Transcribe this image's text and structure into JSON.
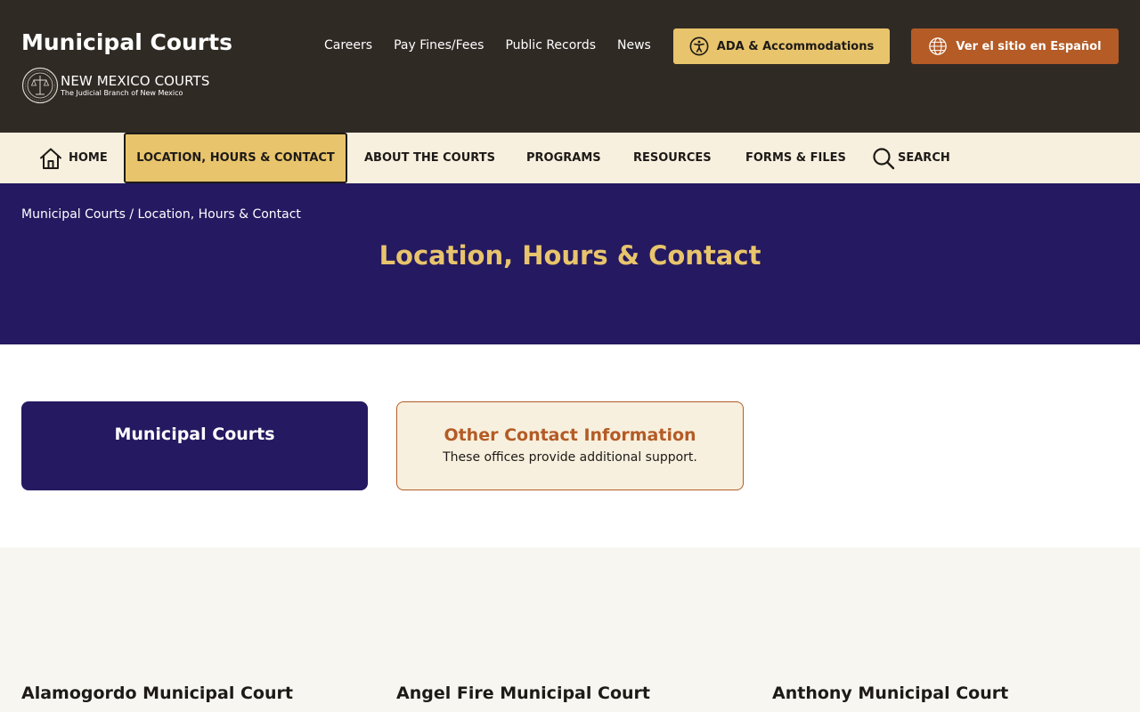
{
  "header": {
    "site_title": "Municipal Courts",
    "brand_name": "NEW MEXICO COURTS",
    "brand_tagline": "The Judicial Branch of New Mexico",
    "utility_links": [
      {
        "label": "Careers"
      },
      {
        "label": "Pay Fines/Fees"
      },
      {
        "label": "Public Records"
      },
      {
        "label": "News"
      }
    ],
    "ada_button": "ADA & Accommodations",
    "spanish_button": "Ver el sitio en Español"
  },
  "nav": {
    "items": [
      {
        "label": "HOME"
      },
      {
        "label": "LOCATION, HOURS & CONTACT"
      },
      {
        "label": "ABOUT THE COURTS"
      },
      {
        "label": "PROGRAMS"
      },
      {
        "label": "RESOURCES"
      },
      {
        "label": "FORMS & FILES"
      },
      {
        "label": "SEARCH"
      }
    ],
    "active_index": 1
  },
  "hero": {
    "breadcrumb": [
      {
        "label": "Municipal Courts"
      },
      {
        "label": "Location, Hours & Contact"
      }
    ],
    "breadcrumb_separator": " / ",
    "title": "Location, Hours & Contact"
  },
  "cards": [
    {
      "title": "Municipal Courts",
      "description": ""
    },
    {
      "title": "Other Contact Information",
      "description": "These offices provide additional support."
    }
  ],
  "courts": [
    {
      "name": "Alamogordo Municipal Court"
    },
    {
      "name": "Angel Fire Municipal Court"
    },
    {
      "name": "Anthony Municipal Court"
    }
  ],
  "colors": {
    "header_bg": "#302a25",
    "nav_bg": "#f8f0de",
    "hero_bg": "#251961",
    "gold": "#e8c46c",
    "rust": "#b45b26",
    "listing_bg": "#f8f6f1"
  },
  "icons": {
    "accessibility": "accessibility-icon",
    "globe": "globe-icon",
    "home": "home-icon",
    "search": "search-icon",
    "seal": "court-seal-icon"
  }
}
